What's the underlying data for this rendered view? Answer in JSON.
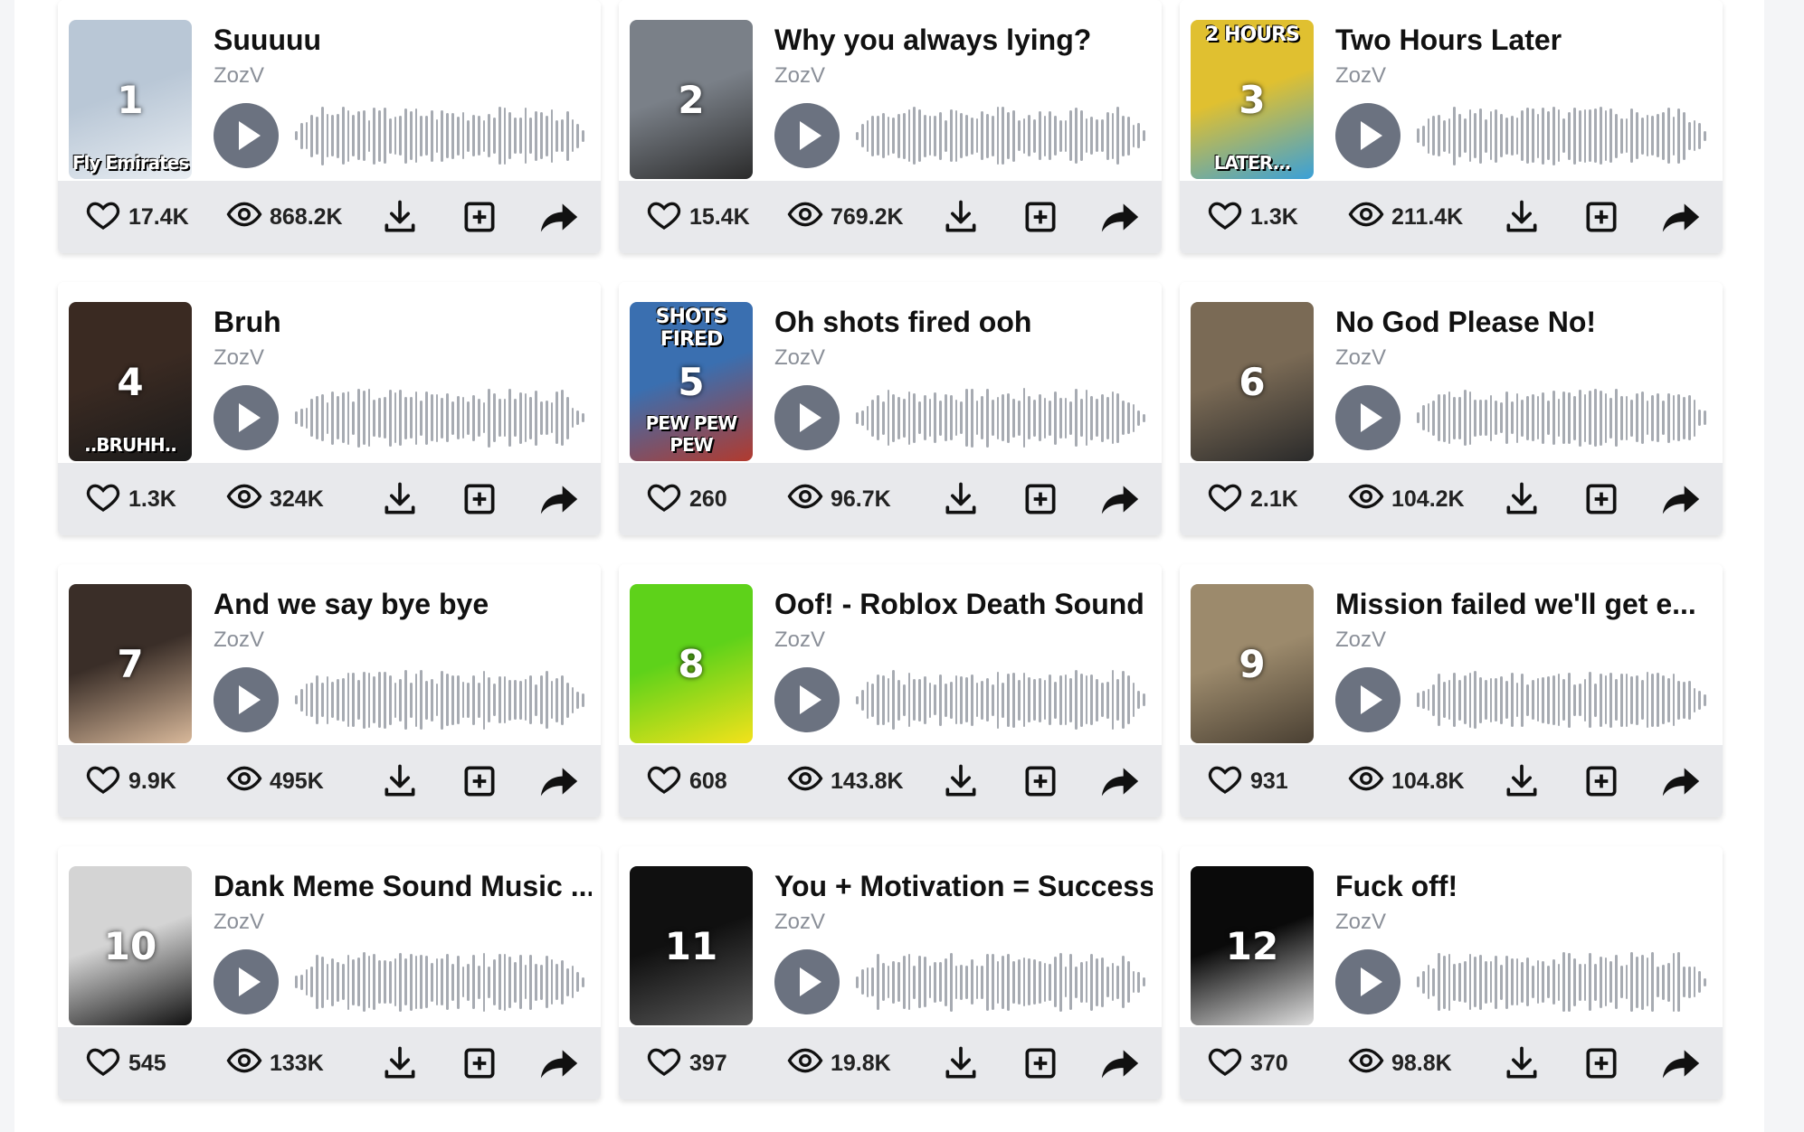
{
  "author": "ZozV",
  "cards": [
    {
      "num": "1",
      "title": "Suuuuu",
      "likes": "17.4K",
      "views": "868.2K",
      "thumb_bg": "#b9c7d6",
      "thumb_fg": "#e8edf2",
      "top_caption": "",
      "bottom_caption": "Fly Emirates"
    },
    {
      "num": "2",
      "title": "Why you always lying?",
      "likes": "15.4K",
      "views": "769.2K",
      "thumb_bg": "#7a8088",
      "thumb_fg": "#2b2b2b",
      "top_caption": "",
      "bottom_caption": ""
    },
    {
      "num": "3",
      "title": "Two Hours Later",
      "likes": "1.3K",
      "views": "211.4K",
      "thumb_bg": "#e0c030",
      "thumb_fg": "#3aa0d8",
      "top_caption": "2 HOURS",
      "bottom_caption": "LATER..."
    },
    {
      "num": "4",
      "title": "Bruh",
      "likes": "1.3K",
      "views": "324K",
      "thumb_bg": "#3a2a22",
      "thumb_fg": "#1a1a1a",
      "top_caption": "",
      "bottom_caption": "..BRUHH.."
    },
    {
      "num": "5",
      "title": "Oh shots fired ooh",
      "likes": "260",
      "views": "96.7K",
      "thumb_bg": "#3a6fb0",
      "thumb_fg": "#b23a2e",
      "top_caption": "SHOTS FIRED",
      "bottom_caption": "PEW PEW PEW"
    },
    {
      "num": "6",
      "title": "No God Please No!",
      "likes": "2.1K",
      "views": "104.2K",
      "thumb_bg": "#7a6a55",
      "thumb_fg": "#2a2a2a",
      "top_caption": "",
      "bottom_caption": ""
    },
    {
      "num": "7",
      "title": "And we say bye bye",
      "likes": "9.9K",
      "views": "495K",
      "thumb_bg": "#3a2e28",
      "thumb_fg": "#d8b89a",
      "top_caption": "",
      "bottom_caption": ""
    },
    {
      "num": "8",
      "title": "Oof! - Roblox Death Sound",
      "likes": "608",
      "views": "143.8K",
      "thumb_bg": "#5ed21a",
      "thumb_fg": "#f3e21b",
      "top_caption": "",
      "bottom_caption": ""
    },
    {
      "num": "9",
      "title": "Mission failed we'll get e...",
      "likes": "931",
      "views": "104.8K",
      "thumb_bg": "#9c8a6c",
      "thumb_fg": "#4a4033",
      "top_caption": "",
      "bottom_caption": ""
    },
    {
      "num": "10",
      "title": "Dank Meme Sound Music ...",
      "likes": "545",
      "views": "133K",
      "thumb_bg": "#d4d4d4",
      "thumb_fg": "#111111",
      "top_caption": "",
      "bottom_caption": ""
    },
    {
      "num": "11",
      "title": "You + Motivation = Success",
      "likes": "397",
      "views": "19.8K",
      "thumb_bg": "#101010",
      "thumb_fg": "#5a5a5a",
      "top_caption": "",
      "bottom_caption": ""
    },
    {
      "num": "12",
      "title": "Fuck off!",
      "likes": "370",
      "views": "98.8K",
      "thumb_bg": "#0a0a0a",
      "thumb_fg": "#e0e0e0",
      "top_caption": "",
      "bottom_caption": ""
    }
  ],
  "icons": {
    "like": "heart-icon",
    "views": "eye-icon",
    "download": "download-icon",
    "add": "plus-square-icon",
    "share": "share-icon",
    "play": "play-icon"
  }
}
